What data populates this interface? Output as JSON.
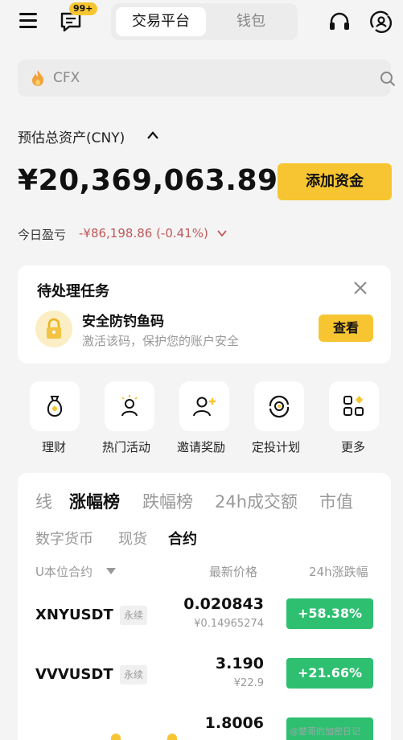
{
  "header": {
    "badge": "99+",
    "tabs": [
      {
        "label": "交易平台",
        "active": true
      },
      {
        "label": "钱包",
        "active": false
      }
    ]
  },
  "search": {
    "placeholder": "CFX"
  },
  "assets": {
    "label": "预估总资产(CNY)",
    "amount": "¥20,369,063.89",
    "add_funds": "添加资金",
    "pnl_label": "今日盈亏",
    "pnl_value": "-¥86,198.86 (-0.41%)"
  },
  "tasks": {
    "title": "待处理任务",
    "item_title": "安全防钓鱼码",
    "item_desc": "激活该码，保护您的账户安全",
    "action": "查看"
  },
  "quick_actions": [
    {
      "label": "理财",
      "icon": "money-bag-icon"
    },
    {
      "label": "热门活动",
      "icon": "hot-activity-icon"
    },
    {
      "label": "邀请奖励",
      "icon": "invite-user-icon"
    },
    {
      "label": "定投计划",
      "icon": "recurring-plan-icon"
    },
    {
      "label": "更多",
      "icon": "more-grid-icon"
    }
  ],
  "market": {
    "tabs": [
      "线",
      "涨幅榜",
      "跌幅榜",
      "24h成交额",
      "市值"
    ],
    "active_tab": "涨幅榜",
    "subtabs": [
      "数字货币",
      "现货",
      "合约"
    ],
    "active_subtab": "合约",
    "columns": {
      "name": "U本位合约",
      "price": "最新价格",
      "change": "24h涨跌幅"
    },
    "rows": [
      {
        "symbol": "XNYUSDT",
        "tag": "永续",
        "price": "0.020843",
        "cny": "¥0.14965274",
        "change": "+58.38%"
      },
      {
        "symbol": "VVVUSDT",
        "tag": "永续",
        "price": "3.190",
        "cny": "¥22.9",
        "change": "+21.66%"
      },
      {
        "symbol": "",
        "tag": "",
        "price": "1.8006",
        "cny": "",
        "change": ""
      }
    ]
  },
  "colors": {
    "accent": "#f6c531",
    "up": "#2fbf71",
    "down": "#c0585a"
  },
  "watermark": "@楚哥的加密日记"
}
